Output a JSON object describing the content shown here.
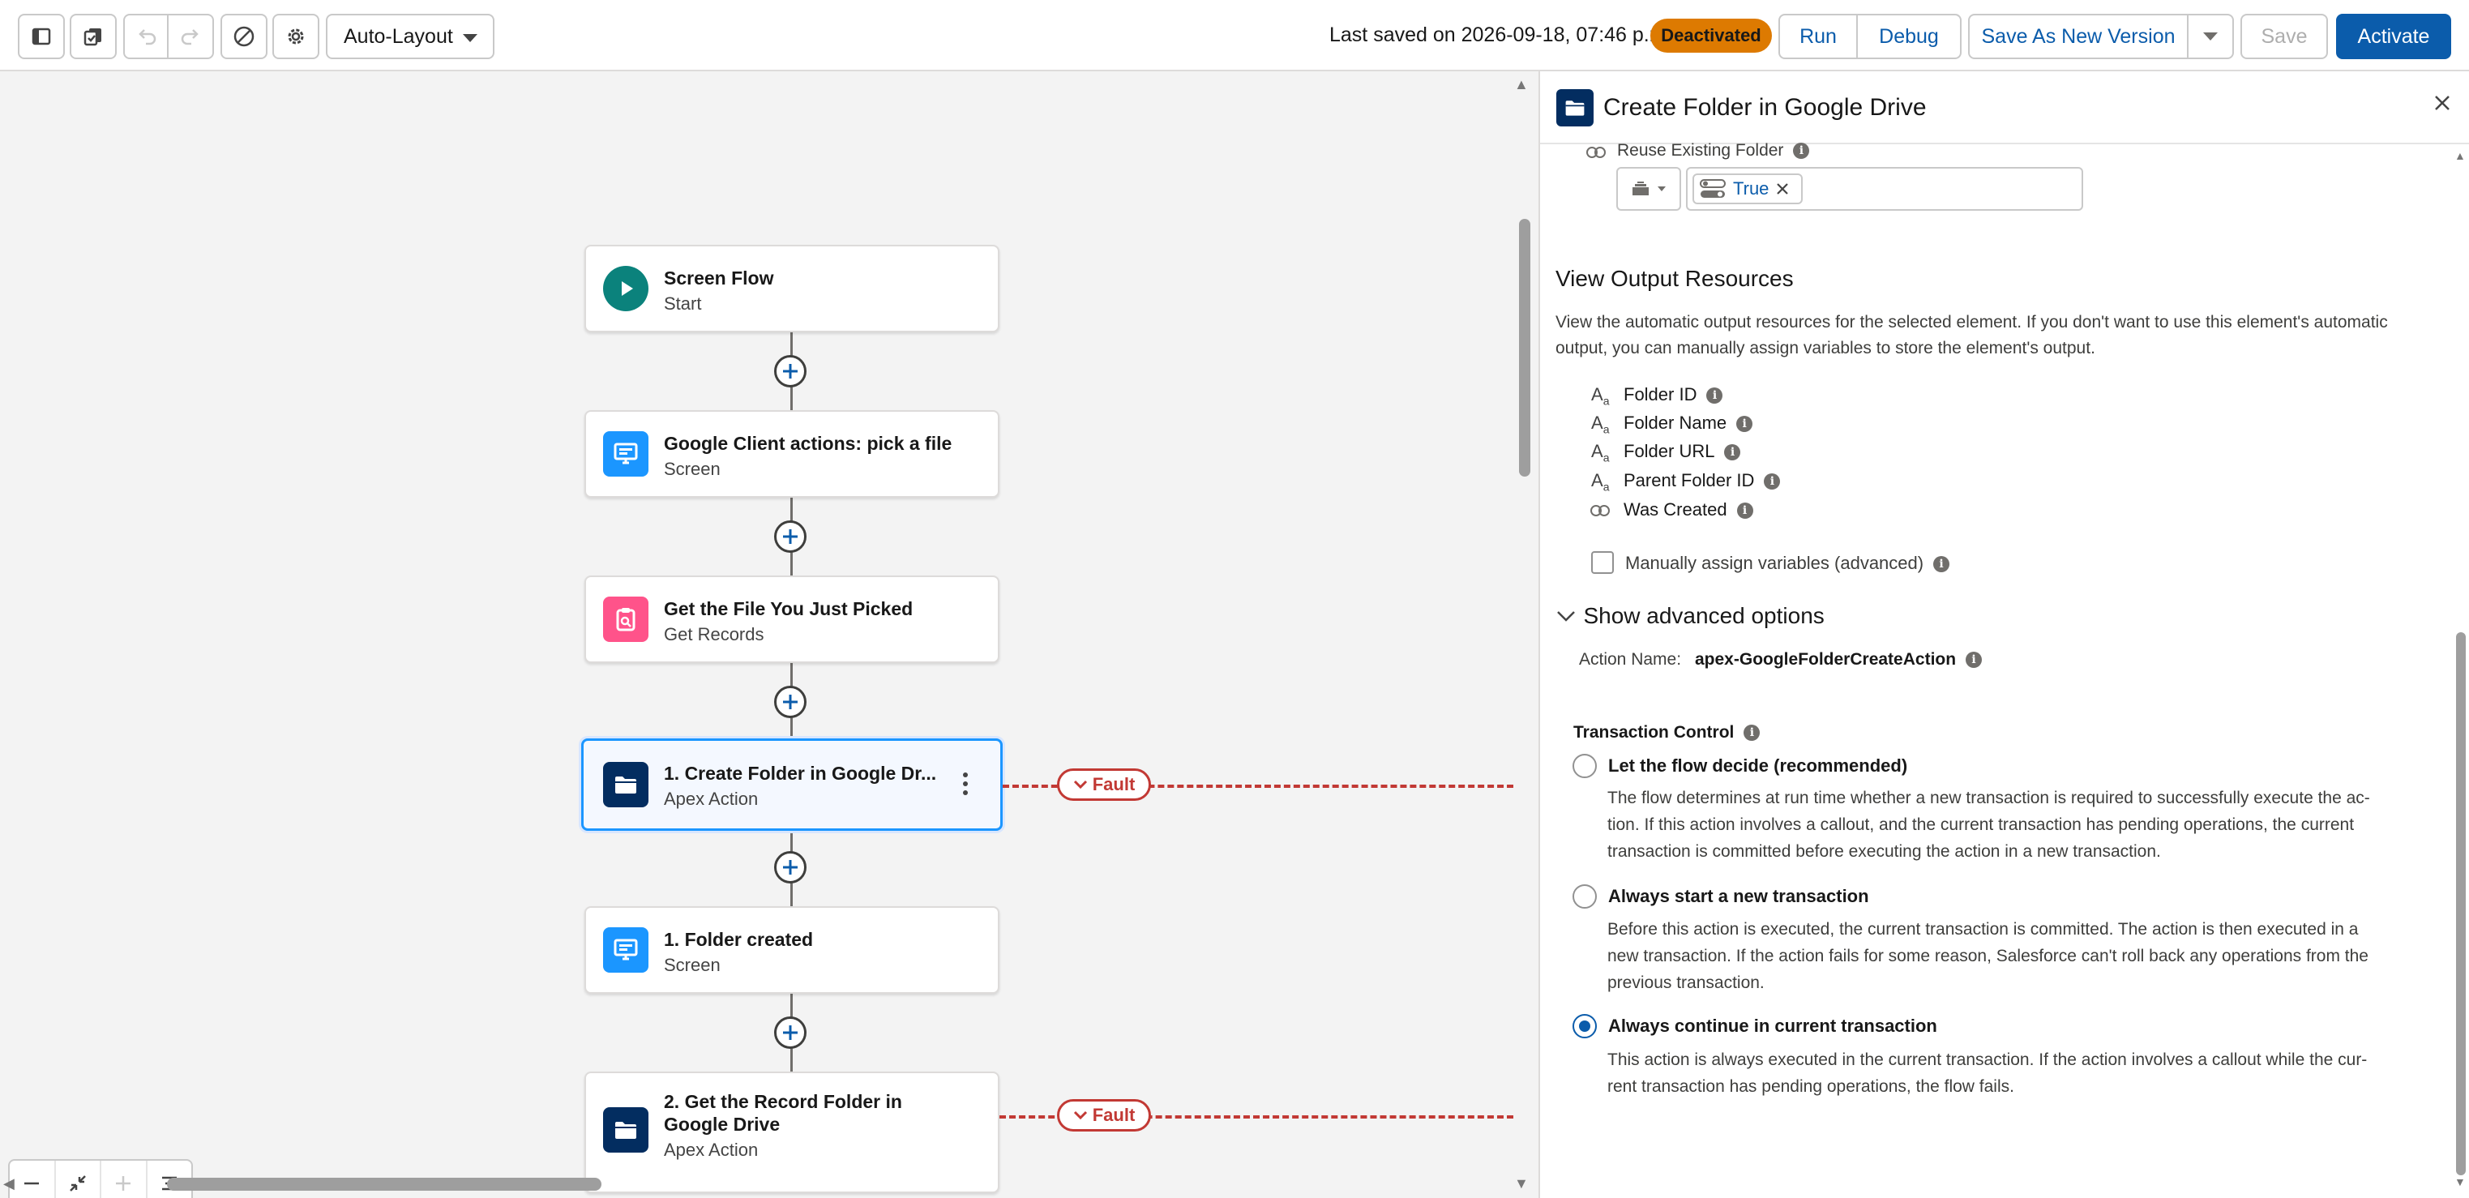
{
  "toolbar": {
    "layout_select": "Auto-Layout",
    "last_saved": "Last saved on 2026-09-18, 07:46 p.m.",
    "status_badge": "Deactivated",
    "run": "Run",
    "debug": "Debug",
    "save_as_new_version": "Save As New Version",
    "save": "Save",
    "activate": "Activate"
  },
  "canvas": {
    "nodes": [
      {
        "title": "Screen Flow",
        "subtitle": "Start",
        "icon": "play-icon",
        "color": "#0b827c"
      },
      {
        "title": "Google Client actions: pick a file",
        "subtitle": "Screen",
        "icon": "screen-icon",
        "color": "#1b96ff"
      },
      {
        "title": "Get the File You Just Picked",
        "subtitle": "Get Records",
        "icon": "record-lookup-icon",
        "color": "#ff538a"
      },
      {
        "title": "1. Create Folder in Google Dr...",
        "subtitle": "Apex Action",
        "icon": "folder-icon",
        "color": "#032d60"
      },
      {
        "title": "1. Folder created",
        "subtitle": "Screen",
        "icon": "screen-icon",
        "color": "#1b96ff"
      },
      {
        "title": "2. Get the Record Folder in",
        "title2": "Google Drive",
        "subtitle": "Apex Action",
        "icon": "folder-icon",
        "color": "#032d60"
      }
    ],
    "fault_label": "Fault"
  },
  "panel": {
    "title": "Create Folder in Google Drive",
    "reuse_label": "Reuse Existing Folder",
    "reuse_value": "True",
    "output_heading": "View Output Resources",
    "output_desc_1": "View the automatic output resources for the selected element. If you don't want to use this element's automatic",
    "output_desc_2": "output, you can manually assign variables to store the element's output.",
    "outputs": [
      "Folder ID",
      "Folder Name",
      "Folder URL",
      "Parent Folder ID",
      "Was Created"
    ],
    "manual_assign": "Manually assign variables (advanced)",
    "advanced_toggle": "Show advanced options",
    "action_name_label": "Action Name:",
    "action_name_value": "apex-GoogleFolderCreateAction",
    "transaction_label": "Transaction Control",
    "options": [
      {
        "label": "Let the flow decide (recommended)",
        "lines": [
          "The flow determines at run time whether a new transaction is required to successfully execute the ac-",
          "tion. If this action involves a callout, and the current transaction has pending operations, the current",
          "transaction is committed before executing the action in a new transaction."
        ]
      },
      {
        "label": "Always start a new transaction",
        "lines": [
          "Before this action is executed, the current transaction is committed. The action is then executed in a",
          "new transaction. If the action fails for some reason, Salesforce can't roll back any operations from the",
          "previous transaction."
        ]
      },
      {
        "label": "Always continue in current transaction",
        "lines": [
          "This action is always executed in the current transaction. If the action involves a callout while the cur-",
          "rent transaction has pending operations, the flow fails."
        ]
      }
    ]
  }
}
